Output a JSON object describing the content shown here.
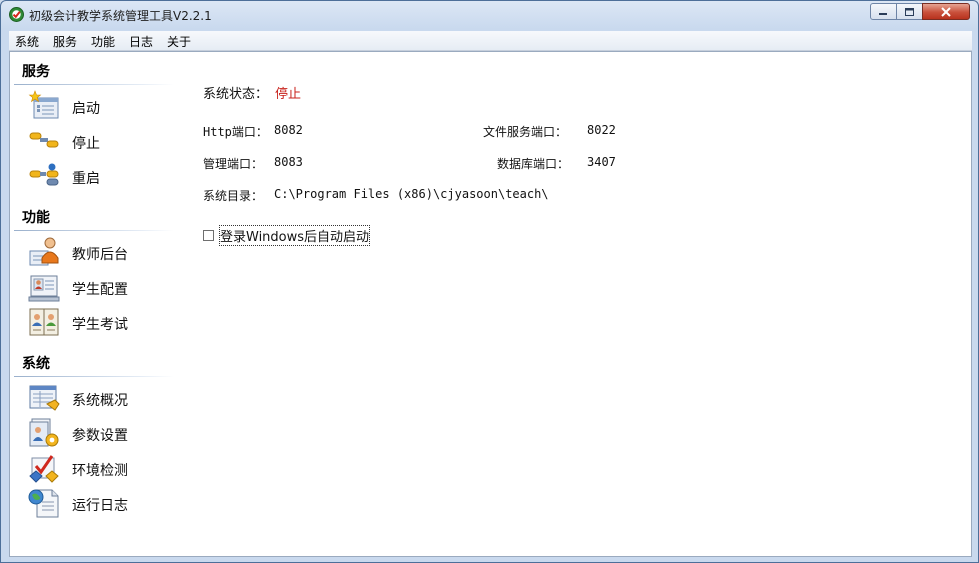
{
  "window": {
    "title": "初级会计教学系统管理工具V2.2.1"
  },
  "menu": [
    "系统",
    "服务",
    "功能",
    "日志",
    "关于"
  ],
  "sections": {
    "service": {
      "title": "服务",
      "items": [
        {
          "label": "启动",
          "icon": "start-service-icon"
        },
        {
          "label": "停止",
          "icon": "stop-service-icon"
        },
        {
          "label": "重启",
          "icon": "restart-service-icon"
        }
      ]
    },
    "function": {
      "title": "功能",
      "items": [
        {
          "label": "教师后台",
          "icon": "teacher-icon"
        },
        {
          "label": "学生配置",
          "icon": "student-config-icon"
        },
        {
          "label": "学生考试",
          "icon": "student-exam-icon"
        }
      ]
    },
    "system": {
      "title": "系统",
      "items": [
        {
          "label": "系统概况",
          "icon": "system-overview-icon"
        },
        {
          "label": "参数设置",
          "icon": "settings-icon"
        },
        {
          "label": "环境检测",
          "icon": "env-check-icon"
        },
        {
          "label": "运行日志",
          "icon": "log-icon"
        }
      ]
    }
  },
  "status": {
    "label": "系统状态：",
    "value": "停止",
    "value_color": "#c8211b"
  },
  "info": {
    "http_port_label": "Http端口：",
    "http_port": "8082",
    "file_port_label": "文件服务端口：",
    "file_port": "8022",
    "admin_port_label": "管理端口：",
    "admin_port": "8083",
    "db_port_label": "数据库端口：",
    "db_port": "3407",
    "dir_label": "系统目录：",
    "dir": "C:\\Program Files (x86)\\cjyasoon\\teach\\"
  },
  "autostart": {
    "label": "登录Windows后自动启动",
    "checked": false
  }
}
